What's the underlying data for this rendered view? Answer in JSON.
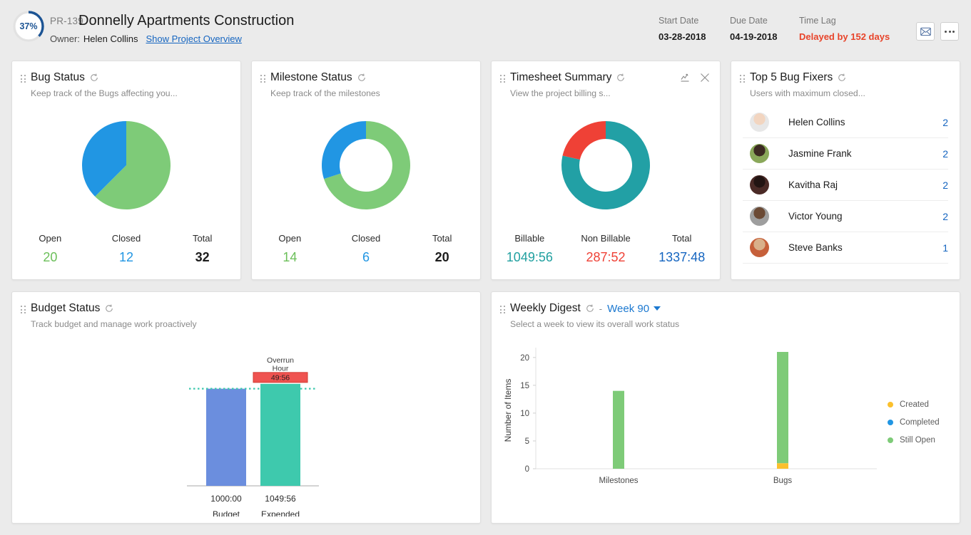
{
  "header": {
    "progress_percent": "37%",
    "progress_value": 37,
    "project_code": "PR-139",
    "project_title": "Donnelly Apartments Construction",
    "owner_label": "Owner:",
    "owner_name": "Helen Collins",
    "overview_link": "Show Project Overview",
    "start_date_label": "Start Date",
    "start_date_value": "03-28-2018",
    "due_date_label": "Due Date",
    "due_date_value": "04-19-2018",
    "time_lag_label": "Time Lag",
    "time_lag_value": "Delayed by 152 days",
    "mail_icon": "mail-icon",
    "more_icon": "more-options-icon",
    "colors": {
      "ring": "#1c5494",
      "delay": "#e8442a",
      "link": "#1565c0"
    }
  },
  "cards": {
    "bug_status": {
      "title": "Bug Status",
      "subtitle": "Keep track of the Bugs affecting you...",
      "refresh_icon": "refresh-icon",
      "stats": [
        {
          "key": "Open",
          "value": "20",
          "color_class": "v-green"
        },
        {
          "key": "Closed",
          "value": "12",
          "color_class": "v-blue"
        },
        {
          "key": "Total",
          "value": "32",
          "color_class": "v-dark"
        }
      ]
    },
    "milestone_status": {
      "title": "Milestone Status",
      "subtitle": "Keep track of the milestones",
      "refresh_icon": "refresh-icon",
      "stats": [
        {
          "key": "Open",
          "value": "14",
          "color_class": "v-green"
        },
        {
          "key": "Closed",
          "value": "6",
          "color_class": "v-blue"
        },
        {
          "key": "Total",
          "value": "20",
          "color_class": "v-dark"
        }
      ]
    },
    "timesheet_summary": {
      "title": "Timesheet Summary",
      "subtitle": "View the project billing s...",
      "refresh_icon": "refresh-icon",
      "chart_action_icon": "line-chart-icon",
      "close_icon": "close-icon",
      "stats": [
        {
          "key": "Billable",
          "value": "1049:56",
          "color_class": "v-teal"
        },
        {
          "key": "Non Billable",
          "value": "287:52",
          "color_class": "v-red"
        },
        {
          "key": "Total",
          "value": "1337:48",
          "color_class": "v-navy"
        }
      ]
    },
    "top_bug_fixers": {
      "title": "Top 5 Bug Fixers",
      "subtitle": "Users with maximum closed...",
      "refresh_icon": "refresh-icon",
      "rows": [
        {
          "name": "Helen Collins",
          "count": "2",
          "avatar": "avatar-helen-collins",
          "c1": "#f2d5c0",
          "c2": "#e7e7e7"
        },
        {
          "name": "Jasmine Frank",
          "count": "2",
          "avatar": "avatar-jasmine-frank",
          "c1": "#3c2a22",
          "c2": "#8aa85a"
        },
        {
          "name": "Kavitha Raj",
          "count": "2",
          "avatar": "avatar-kavitha-raj",
          "c1": "#221412",
          "c2": "#4a2a26"
        },
        {
          "name": "Victor Young",
          "count": "2",
          "avatar": "avatar-victor-young",
          "c1": "#6b4a35",
          "c2": "#9e9e9e"
        },
        {
          "name": "Steve Banks",
          "count": "1",
          "avatar": "avatar-steve-banks",
          "c1": "#d9b08a",
          "c2": "#c6603a"
        }
      ]
    },
    "budget_status": {
      "title": "Budget Status",
      "subtitle": "Track budget and manage work proactively",
      "refresh_icon": "refresh-icon"
    },
    "weekly_digest": {
      "title": "Weekly Digest",
      "subtitle": "Select a week to view its overall work status",
      "refresh_icon": "refresh-icon",
      "separator": "-",
      "week_selected": "Week 90",
      "caret_icon": "chevron-down-icon"
    }
  },
  "chart_data": [
    {
      "id": "bug-status-pie",
      "type": "pie",
      "title": "Bug Status",
      "categories": [
        "Open",
        "Closed"
      ],
      "values": [
        20,
        12
      ],
      "colors": [
        "#7ecb78",
        "#2196e3"
      ],
      "total": 32,
      "legend": "below-as-stats"
    },
    {
      "id": "milestone-status-donut",
      "type": "pie",
      "title": "Milestone Status",
      "categories": [
        "Open",
        "Closed"
      ],
      "values": [
        14,
        6
      ],
      "colors": [
        "#7ecb78",
        "#2196e3"
      ],
      "total": 20,
      "donut": true,
      "legend": "below-as-stats"
    },
    {
      "id": "timesheet-summary-donut",
      "type": "pie",
      "title": "Timesheet Summary",
      "categories": [
        "Billable",
        "Non Billable"
      ],
      "values": [
        1049.93,
        287.87
      ],
      "value_labels": [
        "1049:56",
        "287:52"
      ],
      "colors": [
        "#22a0a5",
        "#ef4136"
      ],
      "total_label": "1337:48",
      "donut": true,
      "legend": "below-as-stats"
    },
    {
      "id": "budget-status-bar",
      "type": "bar",
      "title": "Budget Status",
      "categories": [
        "Budget",
        "Expended"
      ],
      "value_labels": [
        "1000:00",
        "1049:56"
      ],
      "values": [
        1000.0,
        1049.93
      ],
      "colors": [
        "#6b8ede",
        "#3ec9ad"
      ],
      "annotation": {
        "label_line1": "Overrun",
        "label_line2": "Hour",
        "value": "49:56",
        "color": "#ef5350",
        "border": "#d13b31"
      },
      "threshold_line": {
        "value": 1000.0,
        "color": "#3ec9ad",
        "style": "dotted"
      },
      "xlabel": "",
      "ylabel": "",
      "grid": false
    },
    {
      "id": "weekly-digest-bar",
      "type": "bar",
      "title": "Weekly Digest",
      "stacked": true,
      "categories": [
        "Milestones",
        "Bugs"
      ],
      "series": [
        {
          "name": "Created",
          "color": "#fbc02d",
          "values": [
            0,
            1
          ]
        },
        {
          "name": "Completed",
          "color": "#2196e3",
          "values": [
            0,
            0
          ]
        },
        {
          "name": "Still Open",
          "color": "#7ecb78",
          "values": [
            14,
            20
          ]
        }
      ],
      "ylabel": "Number of Items",
      "xlabel": "",
      "ylim": [
        0,
        21
      ],
      "yticks": [
        0,
        5,
        10,
        15,
        20
      ],
      "grid": false,
      "legend_position": "right"
    }
  ]
}
